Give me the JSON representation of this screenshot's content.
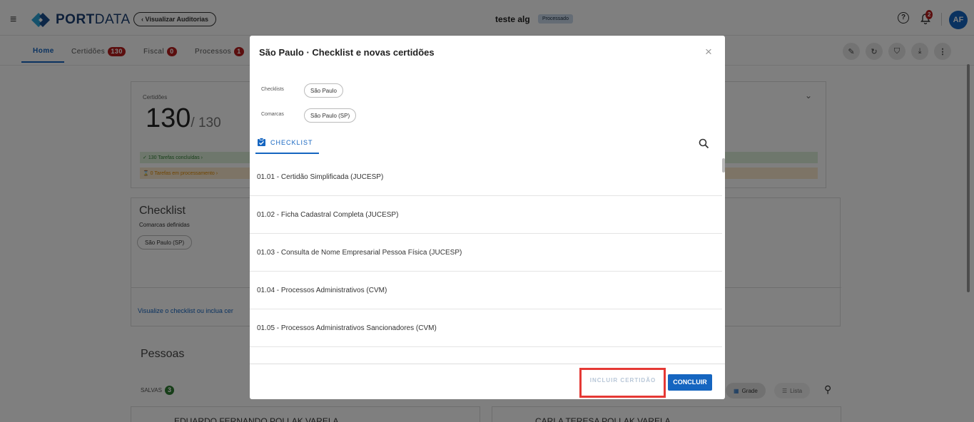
{
  "topbar": {
    "logo_bold": "PORT",
    "logo_light": "DATA",
    "back_button": "‹ Visualizar Auditorias",
    "title": "teste alg",
    "status": "Processado",
    "notifications": "2",
    "avatar": "AF"
  },
  "tabs": [
    {
      "label": "Home"
    },
    {
      "label": "Certidões",
      "badge": "130"
    },
    {
      "label": "Fiscal",
      "badge": "0"
    },
    {
      "label": "Processos",
      "badge": "1"
    }
  ],
  "summary": {
    "label": "Certidões",
    "count": "130",
    "total": "/ 130",
    "done": "130 Tarefas concluídas ›",
    "processing": "0 Tarefas em processamento ›"
  },
  "checklist_card": {
    "title": "Checklist",
    "subtitle": "Comarcas definidas",
    "chip": "São Paulo (SP)",
    "footer": "Visualize o checklist ou inclua cer"
  },
  "people": {
    "title": "Pessoas",
    "saved_label": "SALVAS",
    "saved_count": "3",
    "grid": "Grade",
    "list": "Lista",
    "person1": "EDUARDO FERNANDO POLLAK VARELA",
    "person2": "CARLA TERESA POLLAK VARELA"
  },
  "modal": {
    "title": "São Paulo · Checklist e novas certidões",
    "close": "×",
    "checklists_label": "Checklists",
    "checklists_value": "São Paulo",
    "comarcas_label": "Comarcas",
    "comarcas_value": "São Paulo (SP)",
    "tab": "CHECKLIST",
    "items": [
      "01.01 - Certidão Simplificada (JUCESP)",
      "01.02 - Ficha Cadastral Completa (JUCESP)",
      "01.03 - Consulta de Nome Empresarial Pessoa Física (JUCESP)",
      "01.04 - Processos Administrativos (CVM)",
      "01.05 - Processos Administrativos Sancionadores (CVM)"
    ],
    "include_button": "INCLUIR CERTIDÃO",
    "finish_button": "CONCLUIR"
  },
  "colors": {
    "brand_blue": "#1565c0",
    "badge_red": "#b71c1c",
    "success_green": "#2e7d32",
    "highlight_red": "#e53935"
  },
  "icons": [
    "menu-icon",
    "logo-icon",
    "help-icon",
    "bell-icon",
    "edit-icon",
    "refresh-icon",
    "shield-icon",
    "download-icon",
    "more-icon",
    "close-icon",
    "search-icon",
    "clipboard-icon",
    "grid-icon",
    "list-icon",
    "check-icon",
    "hourglass-icon",
    "chevron-down-icon"
  ]
}
